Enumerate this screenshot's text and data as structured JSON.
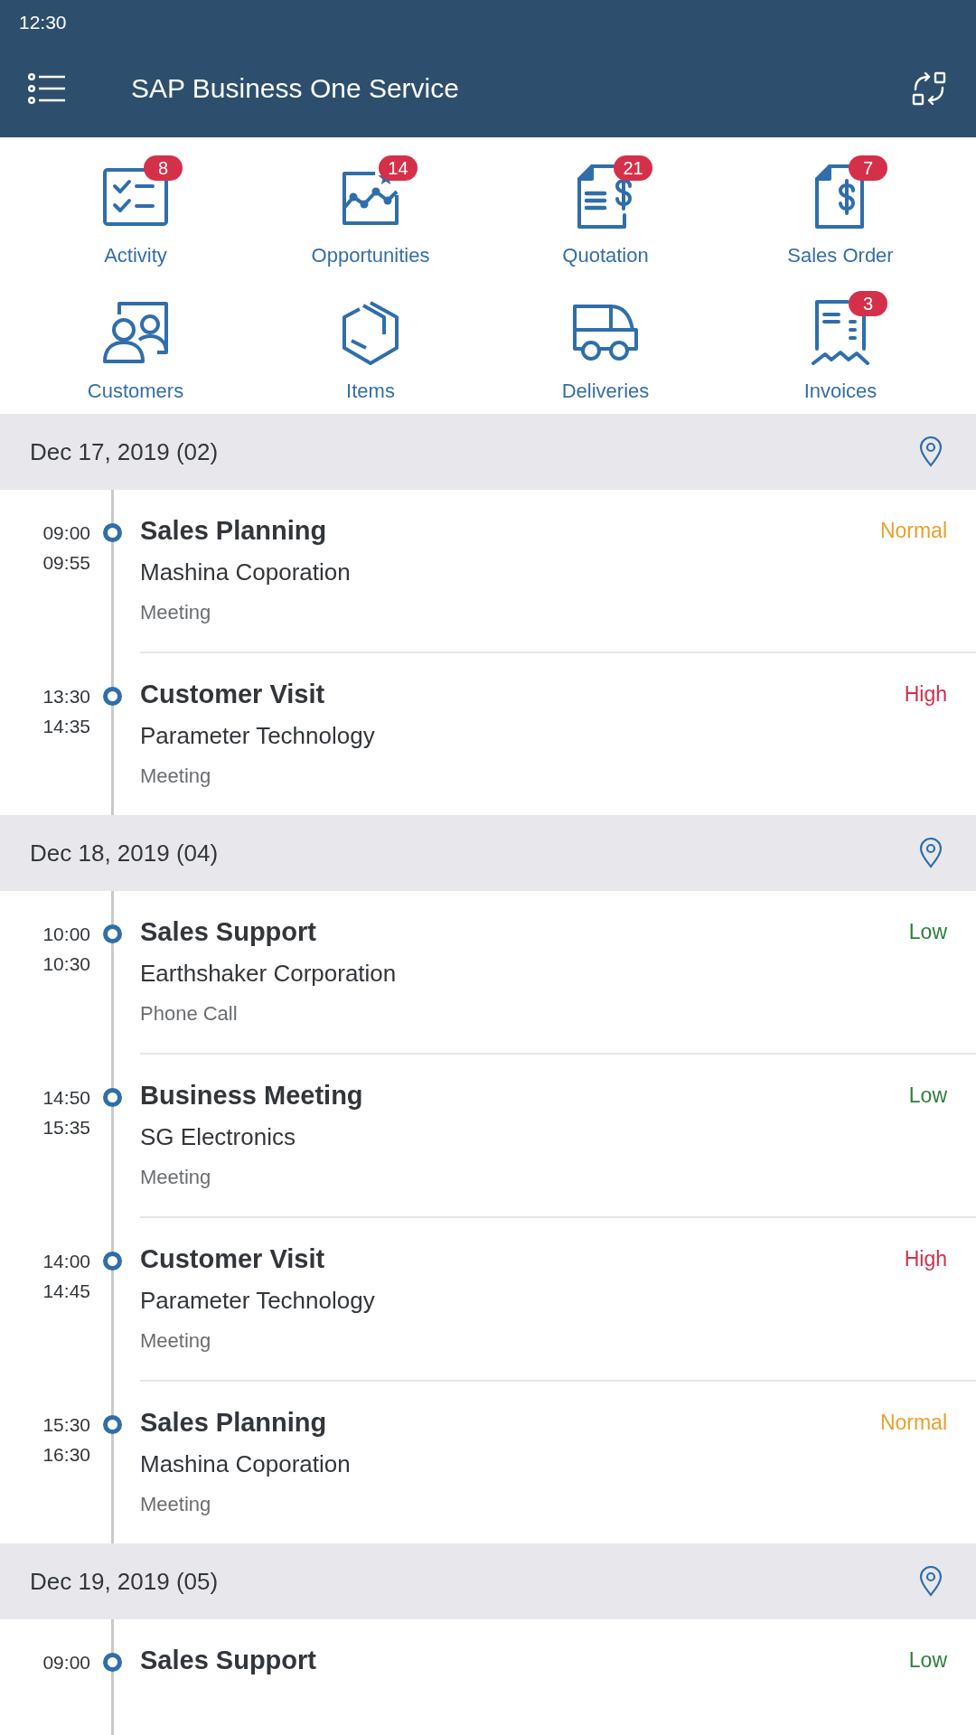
{
  "status_bar": {
    "time": "12:30"
  },
  "app_bar": {
    "title": "SAP Business One Service"
  },
  "shortcuts": [
    {
      "kind": "checklist",
      "label": "Activity",
      "badge": "8"
    },
    {
      "kind": "chart",
      "label": "Opportunities",
      "badge": "14"
    },
    {
      "kind": "quote",
      "label": "Quotation",
      "badge": "21"
    },
    {
      "kind": "order",
      "label": "Sales Order",
      "badge": "7"
    },
    {
      "kind": "people",
      "label": "Customers"
    },
    {
      "kind": "box",
      "label": "Items"
    },
    {
      "kind": "truck",
      "label": "Deliveries"
    },
    {
      "kind": "receipt",
      "label": "Invoices",
      "badge": "3"
    }
  ],
  "days": [
    {
      "date": "Dec 17, 2019 (02)",
      "activities": [
        {
          "start": "09:00",
          "end": "09:55",
          "title": "Sales Planning",
          "company": "Mashina Coporation",
          "type": "Meeting",
          "priority": "Normal",
          "color": "#e9a02b"
        },
        {
          "start": "13:30",
          "end": "14:35",
          "title": "Customer Visit",
          "company": "Parameter Technology",
          "type": "Meeting",
          "priority": "High",
          "color": "#d0304b"
        }
      ]
    },
    {
      "date": "Dec 18, 2019 (04)",
      "activities": [
        {
          "start": "10:00",
          "end": "10:30",
          "title": "Sales Support",
          "company": "Earthshaker Corporation",
          "type": "Phone Call",
          "priority": "Low",
          "color": "#2f7d3c"
        },
        {
          "start": "14:50",
          "end": "15:35",
          "title": "Business Meeting",
          "company": "SG Electronics",
          "type": "Meeting",
          "priority": "Low",
          "color": "#2f7d3c"
        },
        {
          "start": "14:00",
          "end": "14:45",
          "title": "Customer Visit",
          "company": "Parameter Technology",
          "type": "Meeting",
          "priority": "High",
          "color": "#d0304b"
        },
        {
          "start": "15:30",
          "end": "16:30",
          "title": "Sales Planning",
          "company": "Mashina Coporation",
          "type": "Meeting",
          "priority": "Normal",
          "color": "#e9a02b"
        }
      ]
    },
    {
      "date": "Dec 19, 2019 (05)",
      "activities": [
        {
          "start": "09:00",
          "title": "Sales Support",
          "priority": "Low",
          "color": "#2f7d3c"
        }
      ]
    }
  ]
}
